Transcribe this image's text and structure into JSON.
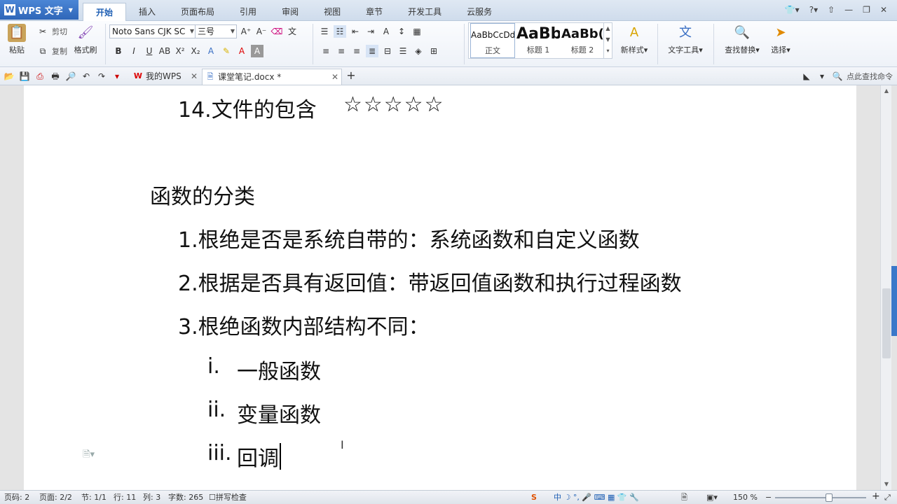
{
  "app": {
    "name": "WPS 文字",
    "menu_tabs": [
      "开始",
      "插入",
      "页面布局",
      "引用",
      "审阅",
      "视图",
      "章节",
      "开发工具",
      "云服务"
    ]
  },
  "ribbon": {
    "paste": "粘贴",
    "cut": "剪切",
    "copy": "复制",
    "format_painter": "格式刷",
    "font_name": "Noto Sans CJK SC",
    "font_size": "三号",
    "style_normal_sample": "AaBbCcDd",
    "style_normal": "正文",
    "style_h1_sample": "AaBb",
    "style_h1": "标题 1",
    "style_h2_sample": "AaBb(",
    "style_h2": "标题 2",
    "new_style": "新样式",
    "text_tools": "文字工具",
    "find_replace": "查找替换",
    "select": "选择"
  },
  "doc_tabs": {
    "my_wps": "我的WPS",
    "doc_name": "课堂笔记.docx *",
    "search_cmd": "点此查找命令"
  },
  "document": {
    "line_heading": "14.文件的包含",
    "line_stars": "☆☆☆☆☆",
    "line_title": "函数的分类",
    "item1": "1.根绝是否是系统自带的：系统函数和自定义函数",
    "item2": "2.根据是否具有返回值：带返回值函数和执行过程函数",
    "item3": "3.根绝函数内部结构不同：",
    "sub1_num": "i.",
    "sub1_text": "一般函数",
    "sub2_num": "ii.",
    "sub2_text": "变量函数",
    "sub3_num": "iii.",
    "sub3_text": "回调"
  },
  "status": {
    "page_no": "页码: 2",
    "pages": "页面: 2/2",
    "section": "节: 1/1",
    "row": "行: 11",
    "col": "列: 3",
    "word_count": "字数: 265",
    "spell_check": "拼写检查",
    "zoom": "150 %",
    "zoom_level": 0.6
  }
}
